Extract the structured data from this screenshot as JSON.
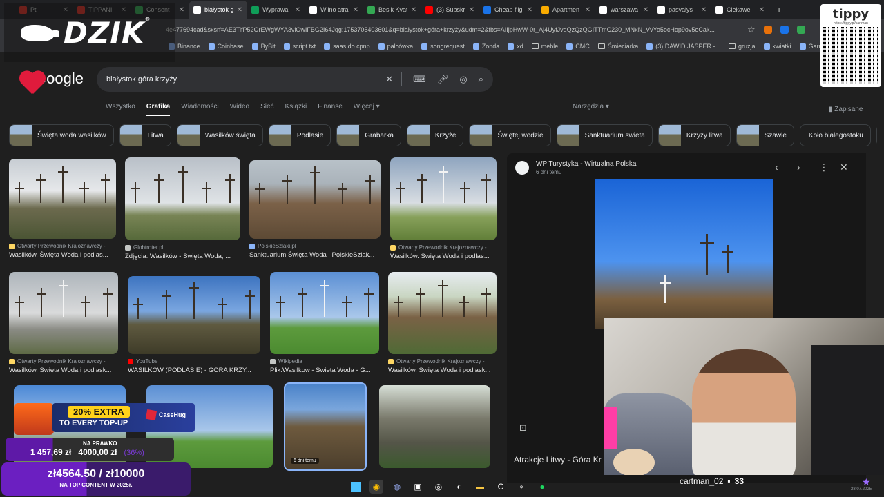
{
  "tabs": [
    {
      "title": "Pt",
      "color": "#d93025"
    },
    {
      "title": "TIPPANI",
      "color": "#d93025"
    },
    {
      "title": "Consent",
      "color": "#34a853"
    },
    {
      "title": "białystok g",
      "color": "#ffffff",
      "active": true
    },
    {
      "title": "Wyprawa",
      "color": "#0f9d58"
    },
    {
      "title": "Wilno atra",
      "color": "#ffffff"
    },
    {
      "title": "Besik Kvat",
      "color": "#34a853"
    },
    {
      "title": "(3) Subskr",
      "color": "#ff0000"
    },
    {
      "title": "Cheap fligh",
      "color": "#1a73e8"
    },
    {
      "title": "Apartmen",
      "color": "#f9ab00"
    },
    {
      "title": "warszawa",
      "color": "#ffffff"
    },
    {
      "title": "pasvalys",
      "color": "#ffffff"
    },
    {
      "title": "Ciekawe",
      "color": "#ffffff"
    }
  ],
  "address": {
    "url": "4e477694cad&sxsrf=AE3TifP52OrEWgWYA3vlOwIFBG2I64Jqg:1753705403601&q=białystok+góra+krzyży&udm=2&fbs=AIIjpHwW-0r_Aj4UyfJvqQzQzQGITTmC230_MNxN_VvYo5ocHop9ov5eCak..."
  },
  "bookmarks": [
    "Binance",
    "Coinbase",
    "ByBit",
    "script.txt",
    "saas do cpnp",
    "palcówka",
    "songrequest",
    "Zonda",
    "xd",
    "meble",
    "CMC",
    "Śmieciarka",
    "(3) DAWID JASPER -...",
    "gruzja",
    "kwiatki",
    "Garmin"
  ],
  "overlay": {
    "brand": "DZIK",
    "reg": "®",
    "tippy": "tippy",
    "tippy_sub": "https://tippy.pl/cartman"
  },
  "google": {
    "logo_text": "Google",
    "query": "białystok góra krzyży"
  },
  "nav": {
    "items": [
      "Wszystko",
      "Grafika",
      "Wiadomości",
      "Wideo",
      "Sieć",
      "Książki",
      "Finanse",
      "Więcej ▾"
    ],
    "tools": "Narzędzia ▾",
    "saved": "Zapisane"
  },
  "chips": [
    "Święta woda wasilków",
    "Litwa",
    "Wasilków święta",
    "Podlasie",
    "Grabarka",
    "Krzyże",
    "Świętej wodzie",
    "Sanktuarium swieta",
    "Krzyzy litwa",
    "Szawle",
    "Koło białegostoku",
    "S"
  ],
  "results": [
    {
      "src": "Otwarty Przewodnik Krajoznawczy -",
      "cap": "Wasilków. Święta Woda i podlas...",
      "color": "#fdd663"
    },
    {
      "src": "Globtroter.pl",
      "cap": "Zdjęcia: Wasilków - Święta Woda, ...",
      "color": "#c4c7c5"
    },
    {
      "src": "PolskieSzlaki.pl",
      "cap": "Sanktuarium Święta Woda | PolskieSzlak...",
      "color": "#8ab4f8"
    },
    {
      "src": "Otwarty Przewodnik Krajoznawczy -",
      "cap": "Wasilków. Święta Woda i podlas...",
      "color": "#fdd663"
    },
    {
      "src": "Otwarty Przewodnik Krajoznawczy -",
      "cap": "Wasilków. Święta Woda i podlask...",
      "color": "#fdd663"
    },
    {
      "src": "YouTube",
      "cap": "WASILKÓW (PODLASIE) - GÓRA KRZY...",
      "color": "#ff0000"
    },
    {
      "src": "Wikipedia",
      "cap": "Plik:Wasilkow - Swieta Woda - G...",
      "color": "#c4c7c5"
    },
    {
      "src": "Otwarty Przewodnik Krajoznawczy -",
      "cap": "Wasilków. Święta Woda i podlask...",
      "color": "#fdd663"
    }
  ],
  "bottom_badge": "6 dni temu",
  "panel": {
    "source": "WP Turystyka - Wirtualna Polska",
    "date": "6 dni temu",
    "caption": "Atrakcje Litwy - Góra Kr"
  },
  "chat": {
    "user": "cartman_02",
    "count": "33"
  },
  "promo": {
    "percent": "20% EXTRA",
    "line": "TO EVERY TOP-UP",
    "brand": "CaseHug"
  },
  "goal1": {
    "label": "NA PRAWKO",
    "current": "1 457,69 zł",
    "target": "4000,00 zł",
    "pct": "(36%)"
  },
  "goal2": {
    "value": "zł4564.50 / zł10000",
    "sub": "NA TOP CONTENT W 2025r."
  },
  "clock": "28.07.2025"
}
